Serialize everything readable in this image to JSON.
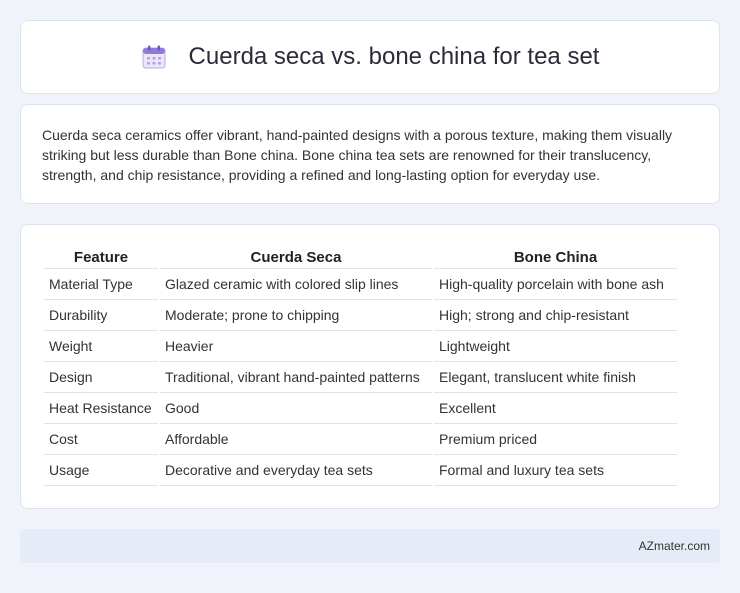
{
  "header": {
    "icon": "calendar-icon",
    "title": "Cuerda seca vs. bone china for tea set"
  },
  "summary": {
    "text": "Cuerda seca ceramics offer vibrant, hand-painted designs with a porous texture, making them visually striking but less durable than Bone china. Bone china tea sets are renowned for their translucency, strength, and chip resistance, providing a refined and long-lasting option for everyday use."
  },
  "table": {
    "headers": [
      "Feature",
      "Cuerda Seca",
      "Bone China"
    ],
    "rows": [
      [
        "Material Type",
        "Glazed ceramic with colored slip lines",
        "High-quality porcelain with bone ash"
      ],
      [
        "Durability",
        "Moderate; prone to chipping",
        "High; strong and chip-resistant"
      ],
      [
        "Weight",
        "Heavier",
        "Lightweight"
      ],
      [
        "Design",
        "Traditional, vibrant hand-painted patterns",
        "Elegant, translucent white finish"
      ],
      [
        "Heat Resistance",
        "Good",
        "Excellent"
      ],
      [
        "Cost",
        "Affordable",
        "Premium priced"
      ],
      [
        "Usage",
        "Decorative and everyday tea sets",
        "Formal and luxury tea sets"
      ]
    ]
  },
  "footer": {
    "brand": "AZmater.com"
  }
}
